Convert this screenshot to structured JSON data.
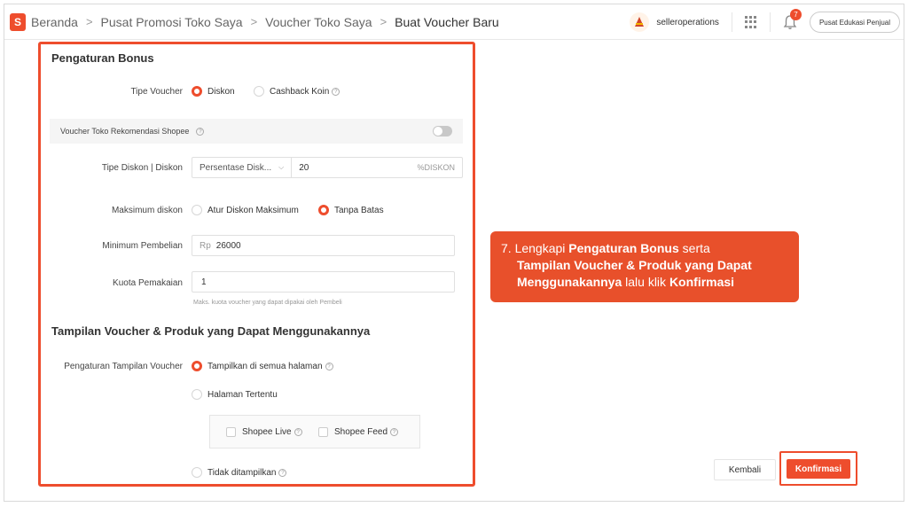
{
  "header": {
    "logo_letter": "S",
    "breadcrumbs": [
      "Beranda",
      "Pusat Promosi Toko Saya",
      "Voucher Toko Saya",
      "Buat Voucher Baru"
    ],
    "separator": ">",
    "username": "selleroperations",
    "notification_count": "7",
    "edu_button": "Pusat Edukasi Penjual"
  },
  "bonus": {
    "title": "Pengaturan Bonus",
    "voucher_type_label": "Tipe Voucher",
    "voucher_type_options": [
      "Diskon",
      "Cashback Koin"
    ],
    "voucher_type_selected": "Diskon",
    "reco_label": "Voucher Toko Rekomendasi Shopee",
    "reco_enabled": false,
    "discount_type_label": "Tipe Diskon | Diskon",
    "discount_type_value": "Persentase Disk...",
    "discount_value": "20",
    "discount_suffix": "%DISKON",
    "max_discount_label": "Maksimum diskon",
    "max_discount_options": [
      "Atur Diskon Maksimum",
      "Tanpa Batas"
    ],
    "max_discount_selected": "Tanpa Batas",
    "min_purchase_label": "Minimum Pembelian",
    "min_purchase_prefix": "Rp",
    "min_purchase_value": "26000",
    "quota_label": "Kuota Pemakaian",
    "quota_value": "1",
    "quota_hint": "Maks. kuota voucher yang dapat dipakai oleh Pembeli"
  },
  "display": {
    "title": "Tampilan Voucher & Produk yang Dapat Menggunakannya",
    "setting_label": "Pengaturan Tampilan Voucher",
    "options": [
      "Tampilkan di semua halaman",
      "Halaman Tertentu",
      "Tidak ditampilkan"
    ],
    "selected": "Tampilkan di semua halaman",
    "sub_options": [
      "Shopee Live",
      "Shopee Feed"
    ]
  },
  "callout": {
    "prefix": "7. Lengkapi ",
    "bold1": "Pengaturan Bonus",
    "mid1": " serta",
    "bold2": "Tampilan Voucher & Produk yang Dapat",
    "bold3": "Menggunakannya",
    "mid2": " lalu klik ",
    "bold4": "Konfirmasi"
  },
  "actions": {
    "back": "Kembali",
    "confirm": "Konfirmasi"
  },
  "colors": {
    "brand": "#ee4d2d",
    "callout_bg": "#e8502b"
  }
}
